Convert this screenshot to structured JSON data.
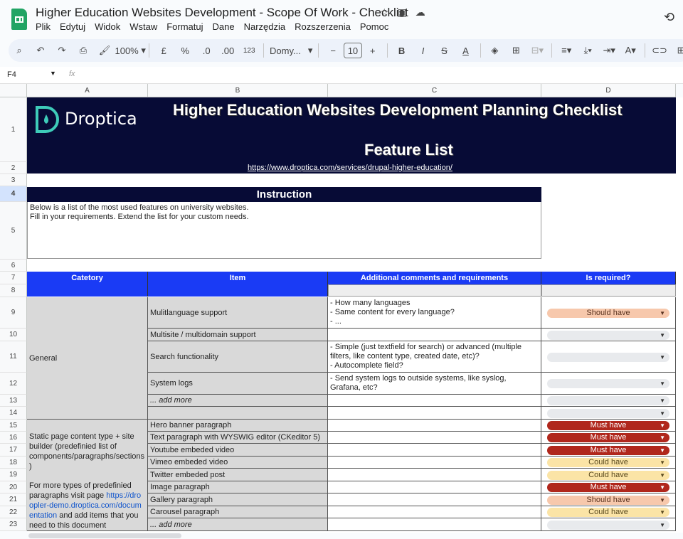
{
  "app": {
    "title": "Higher Education Websites Development - Scope Of Work - Checklist",
    "menu": [
      "Plik",
      "Edytuj",
      "Widok",
      "Wstaw",
      "Formatuj",
      "Dane",
      "Narzędzia",
      "Rozszerzenia",
      "Pomoc"
    ]
  },
  "toolbar": {
    "zoom": "100%",
    "currency": "£",
    "percent": "%",
    "dec_less": ".0",
    "dec_more": ".00",
    "format_num": "123",
    "font": "Domy...",
    "font_size": "10"
  },
  "formula": {
    "cell_ref": "F4",
    "fx": "fx",
    "value": ""
  },
  "columns": [
    "A",
    "B",
    "C",
    "D"
  ],
  "rows": [
    "1",
    "2",
    "3",
    "4",
    "5",
    "6",
    "7",
    "8",
    "9",
    "10",
    "11",
    "12",
    "13",
    "14",
    "15",
    "16",
    "17",
    "18",
    "19",
    "20",
    "21",
    "22",
    "23"
  ],
  "banner": {
    "logo_text": "Droptica",
    "title": "Higher Education Websites Development Planning Checklist",
    "subtitle": "Feature List",
    "link": "https://www.droptica.com/services/drupal-higher-education/"
  },
  "instruction": {
    "header": "Instruction",
    "line1": "Below is a list of the most used features on university websites.",
    "line2": "Fill in your requirements. Extend the list for your custom needs."
  },
  "table": {
    "headers": {
      "category": "Catetory",
      "item": "Item",
      "comments": "Additional comments and requirements",
      "required": "Is required?"
    },
    "general": {
      "category": "General",
      "items": [
        {
          "item": "Mulitlanguage support",
          "comment": "- How many languages\n- Same content for every language?\n- ...",
          "required": "Should have"
        },
        {
          "item": "Multisite / multidomain support",
          "comment": "",
          "required": ""
        },
        {
          "item": "Search functionality",
          "comment": "- Simple (just textfield for search) or advanced (multiple filters, like content type, created date, etc)?\n- Autocomplete field?",
          "required": ""
        },
        {
          "item": "System logs",
          "comment": "- Send system logs to outside systems, like syslog, Grafana, etc?",
          "required": ""
        },
        {
          "item": "... add more",
          "comment": "",
          "required": ""
        },
        {
          "item": "",
          "comment": "",
          "required": ""
        }
      ]
    },
    "static": {
      "category_part1": "Static page content type + site builder (predefinied list of components/paragraphs/sections )",
      "category_part2": "For more types of predefinied paragraphs visit page ",
      "link": "https://droopler-demo.droptica.com/documentation",
      "category_part3": " and add items that you need to this document",
      "items": [
        {
          "item": "Hero banner paragraph",
          "required": "Must have"
        },
        {
          "item": "Text paragraph with WYSWIG editor (CKeditor 5)",
          "required": "Must have"
        },
        {
          "item": "Youtube embeded video",
          "required": "Must have"
        },
        {
          "item": "Vimeo embeded video",
          "required": "Could have"
        },
        {
          "item": "Twitter embeded post",
          "required": "Could have"
        },
        {
          "item": "Image paragraph",
          "required": "Must have"
        },
        {
          "item": "Gallery paragraph",
          "required": "Should have"
        },
        {
          "item": "Carousel paragraph",
          "required": "Could have"
        },
        {
          "item": "... add more",
          "required": ""
        }
      ]
    }
  },
  "colors": {
    "banner": "#070b36",
    "header_blue": "#1a3bf5",
    "must": "#b0271c",
    "should": "#f7c8ac",
    "could": "#fbe4a6"
  }
}
